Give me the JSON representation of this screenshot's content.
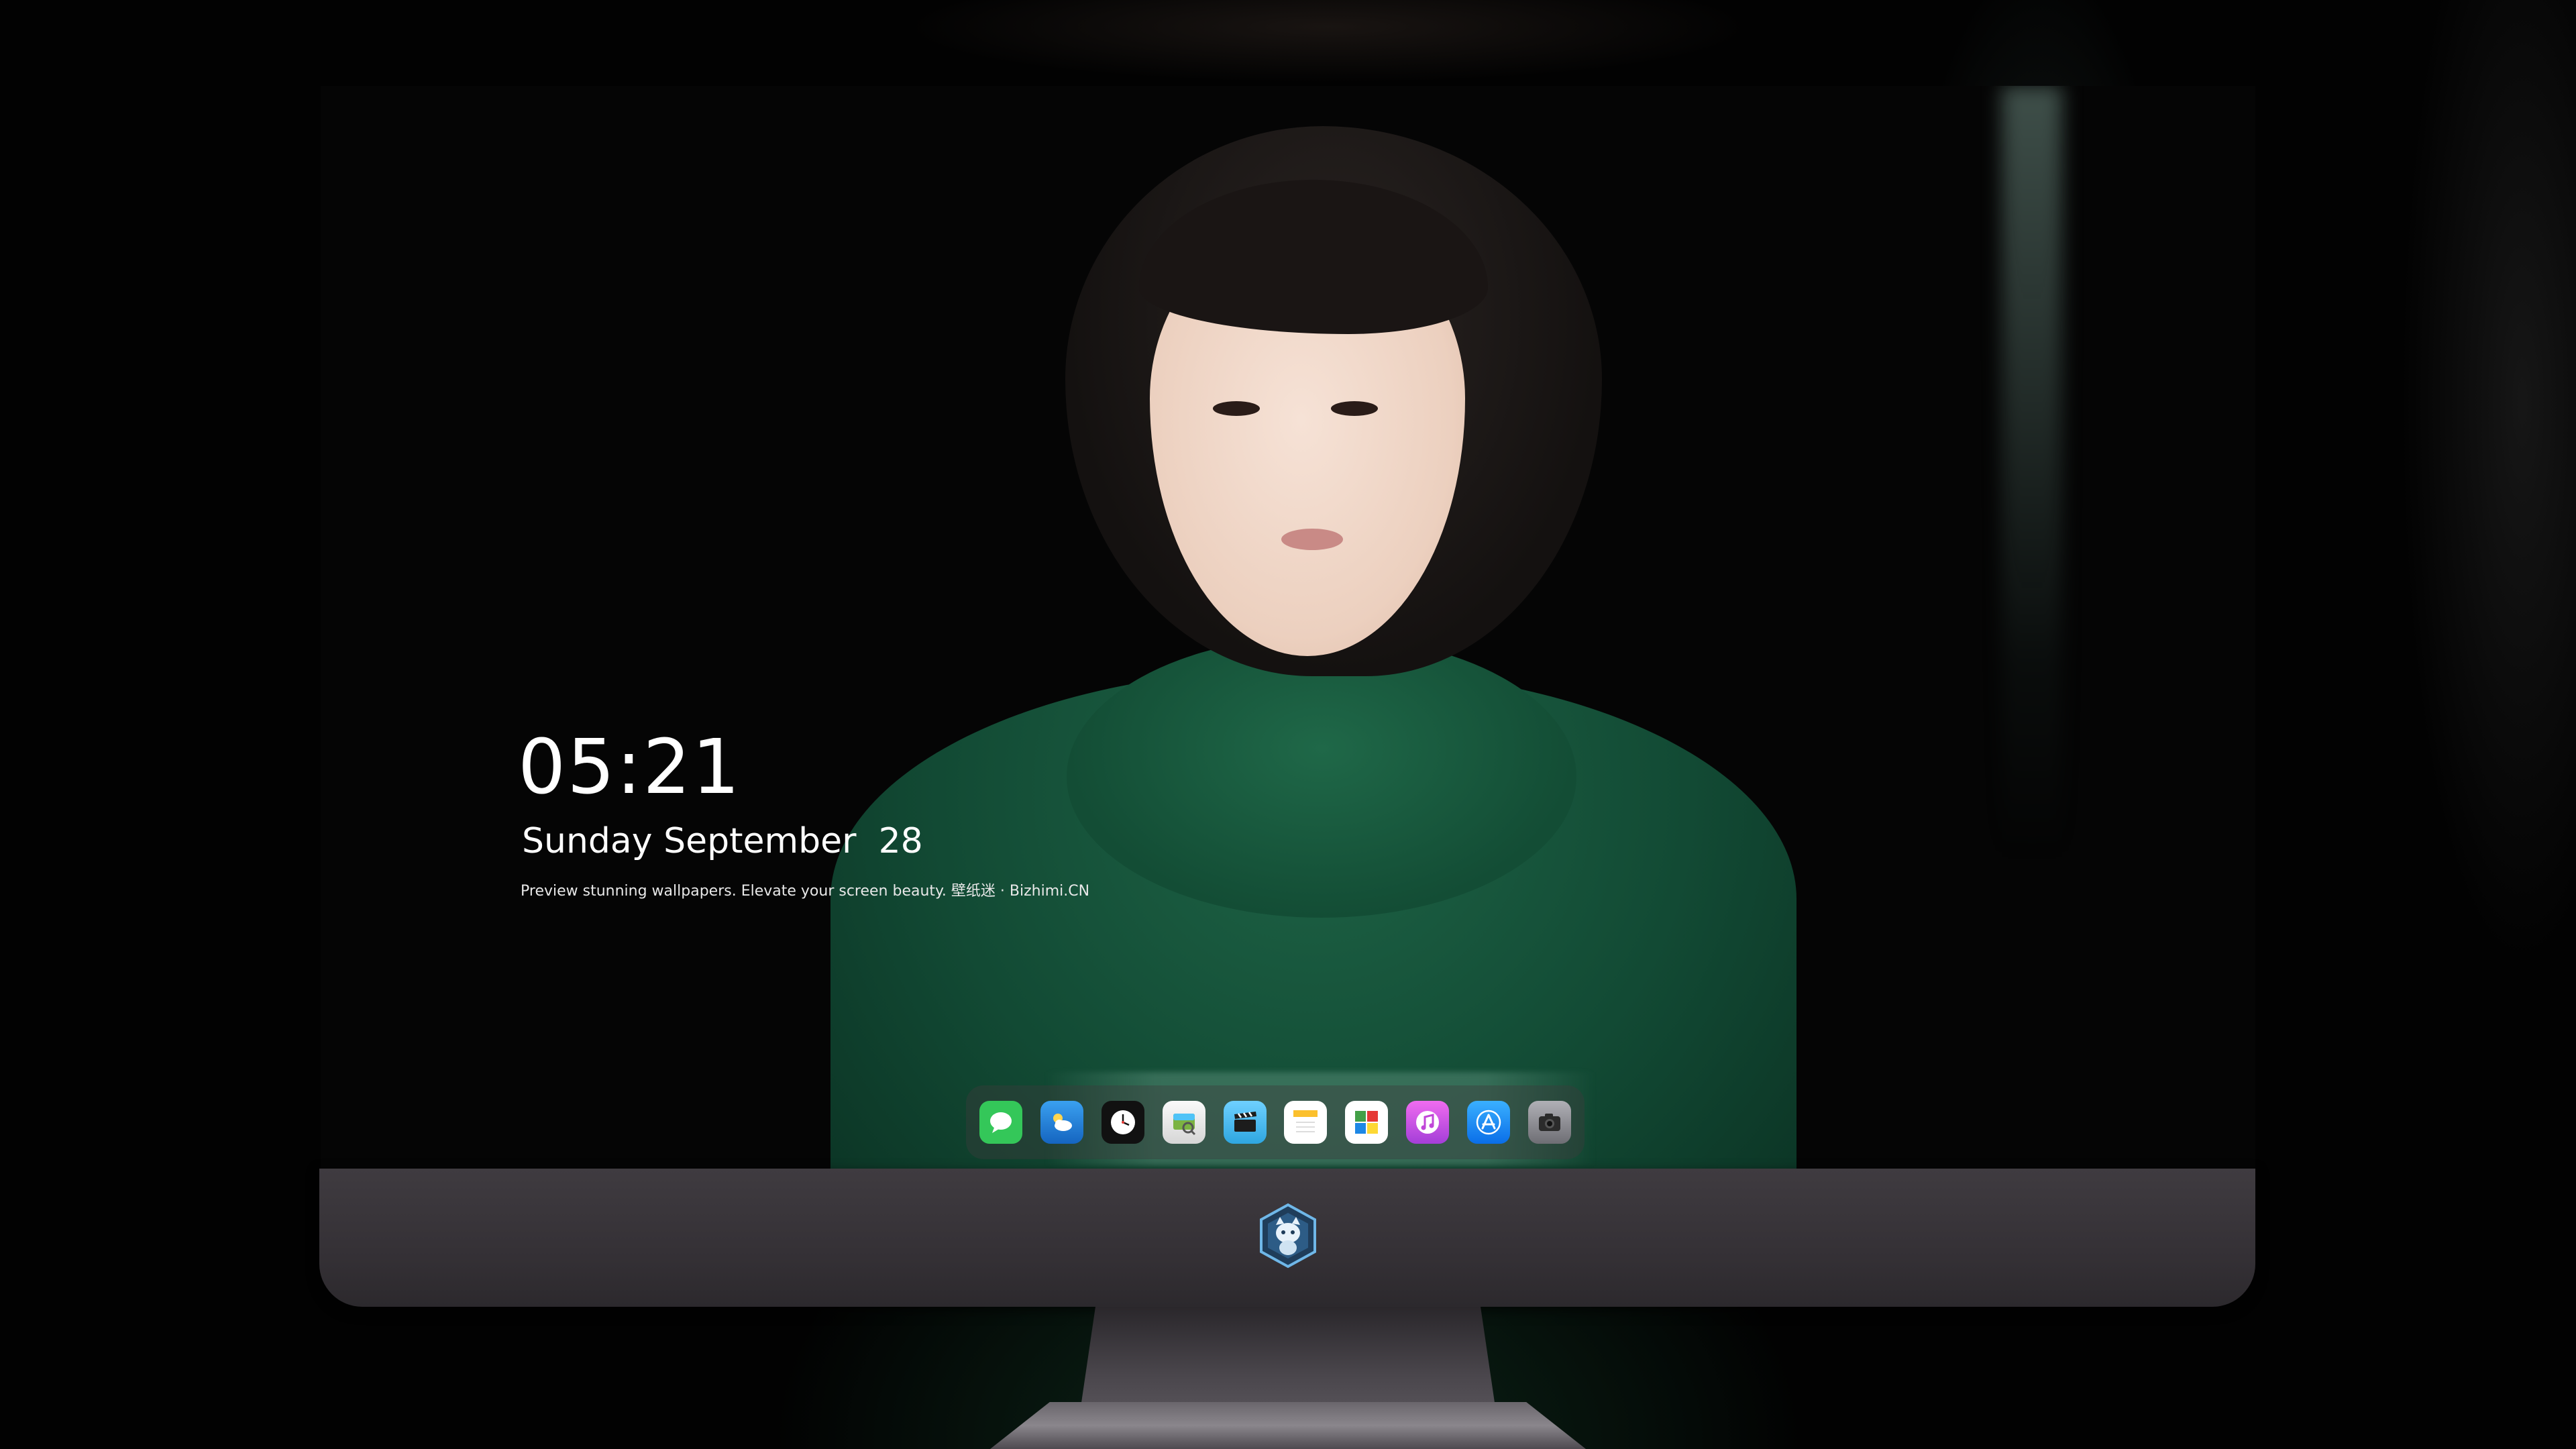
{
  "lockscreen": {
    "time": "05:21",
    "date": "Sunday September  28",
    "tagline": "Preview stunning wallpapers. Elevate your screen beauty. 壁纸迷 · Bizhimi.CN"
  },
  "dock": {
    "apps": [
      {
        "name": "messages",
        "icon": "message-bubble-icon",
        "color": "#34c759"
      },
      {
        "name": "weather",
        "icon": "cloud-sun-icon",
        "color": "#1e88e5"
      },
      {
        "name": "clock",
        "icon": "clock-icon",
        "color": "#111111"
      },
      {
        "name": "preview",
        "icon": "photo-viewer-icon",
        "color": "#f2f2f2"
      },
      {
        "name": "videos",
        "icon": "clapperboard-icon",
        "color": "#4fc3f7"
      },
      {
        "name": "notes",
        "icon": "notes-icon",
        "color": "#fbd34d"
      },
      {
        "name": "photo-booth",
        "icon": "photo-grid-icon",
        "color": "#ffffff"
      },
      {
        "name": "music",
        "icon": "music-note-icon",
        "color": "#d84fd8"
      },
      {
        "name": "app-store",
        "icon": "app-store-icon",
        "color": "#1a8cff"
      },
      {
        "name": "camera",
        "icon": "camera-icon",
        "color": "#8e8e93"
      }
    ]
  },
  "monitor": {
    "chin_logo": "cat-shield-logo"
  }
}
